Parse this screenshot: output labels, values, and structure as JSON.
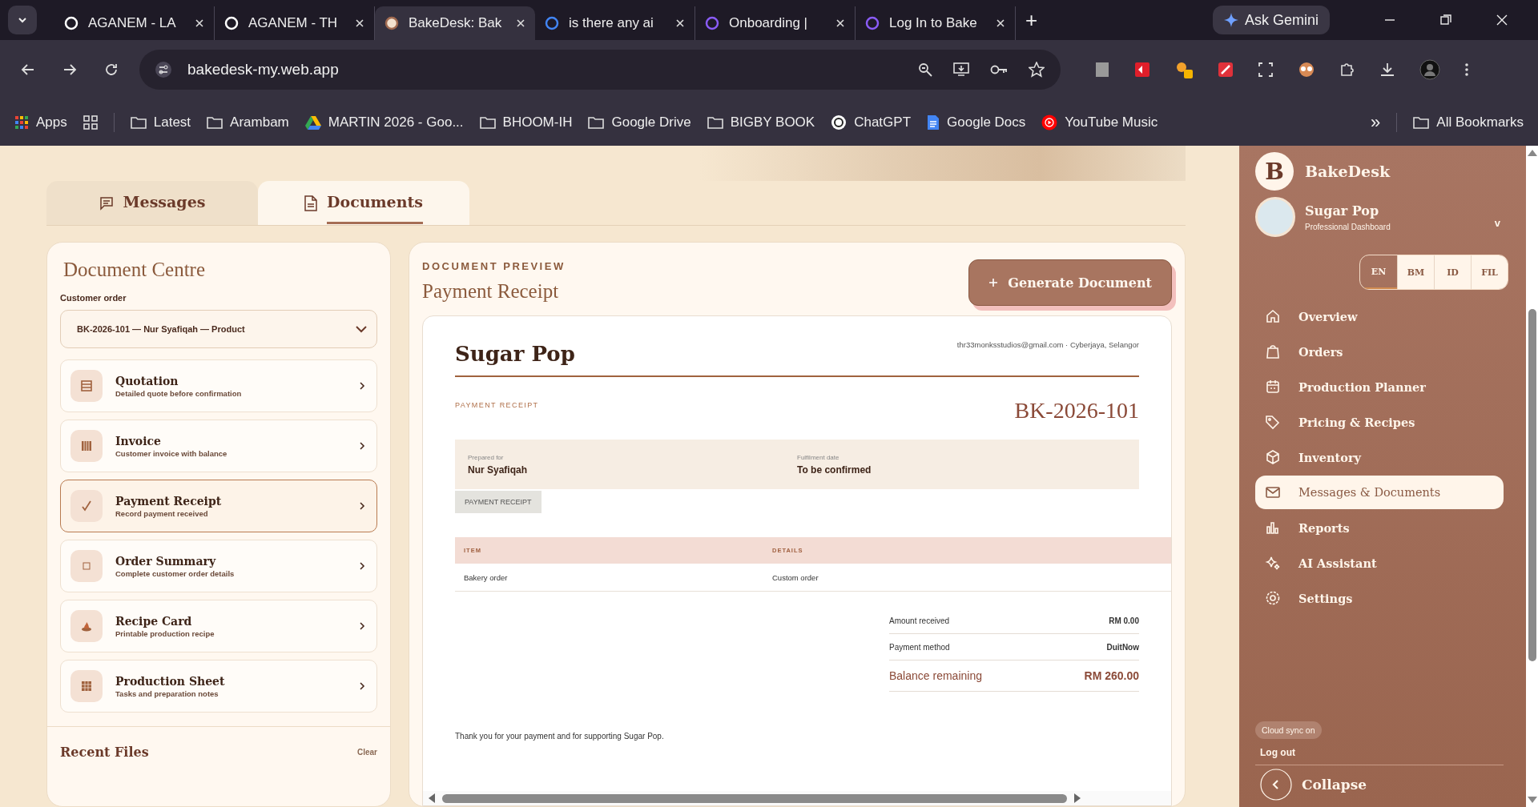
{
  "browser": {
    "tabs": [
      {
        "title": "AGANEM - LA",
        "selected": false
      },
      {
        "title": "AGANEM - TH",
        "selected": false
      },
      {
        "title": "BakeDesk: Bak",
        "selected": true
      },
      {
        "title": "is there any ai",
        "selected": false
      },
      {
        "title": "Onboarding |",
        "selected": false
      },
      {
        "title": "Log In to Bake",
        "selected": false
      }
    ],
    "new_tab": "+",
    "ask_gemini": "Ask Gemini",
    "address": "bakedesk-my.web.app",
    "bookmarks": [
      {
        "label": "Apps",
        "kind": "apps"
      },
      {
        "label": "Latest",
        "kind": "folder"
      },
      {
        "label": "Arambam",
        "kind": "folder"
      },
      {
        "label": "MARTIN 2026 - Goo...",
        "kind": "drive"
      },
      {
        "label": "BHOOM-IH",
        "kind": "folder"
      },
      {
        "label": "Google Drive",
        "kind": "folder"
      },
      {
        "label": "BIGBY BOOK",
        "kind": "folder"
      },
      {
        "label": "ChatGPT",
        "kind": "chat"
      },
      {
        "label": "Google Docs",
        "kind": "docs"
      },
      {
        "label": "YouTube Music",
        "kind": "music"
      }
    ],
    "more": "»",
    "all_bookmarks": "All Bookmarks"
  },
  "page_tabs": [
    {
      "label": "Messages",
      "selected": false
    },
    {
      "label": "Documents",
      "selected": true
    }
  ],
  "document_centre": {
    "title": "Document Centre",
    "order_label": "Customer order",
    "order_value": "BK-2026-101 — Nur Syafiqah — Product",
    "documents": [
      {
        "title": "Quotation",
        "subtitle": "Detailed quote before confirmation",
        "selected": false
      },
      {
        "title": "Invoice",
        "subtitle": "Customer invoice with balance",
        "selected": false
      },
      {
        "title": "Payment Receipt",
        "subtitle": "Record payment received",
        "selected": true
      },
      {
        "title": "Order Summary",
        "subtitle": "Complete customer order details",
        "selected": false
      },
      {
        "title": "Recipe Card",
        "subtitle": "Printable production recipe",
        "selected": false
      },
      {
        "title": "Production Sheet",
        "subtitle": "Tasks and preparation notes",
        "selected": false
      }
    ],
    "recent_files": "Recent Files",
    "clear": "Clear"
  },
  "preview": {
    "eyebrow": "DOCUMENT PREVIEW",
    "title": "Payment Receipt",
    "generate": "Generate Document",
    "document": {
      "business": "Sugar Pop",
      "contact": "thr33monksstudios@gmail.com · Cyberjaya, Selangor",
      "doc_type": "PAYMENT RECEIPT",
      "number": "BK-2026-101",
      "fields": [
        {
          "label": "Prepared for",
          "value": "Nur Syafiqah"
        },
        {
          "label": "Fulfilment date",
          "value": "To be confirmed"
        }
      ],
      "tag": "PAYMENT RECEIPT",
      "columns": [
        "ITEM",
        "DETAILS"
      ],
      "rows": [
        [
          "Bakery order",
          "Custom order"
        ]
      ],
      "totals": [
        {
          "label": "Amount received",
          "value": "RM 0.00",
          "kind": "plain"
        },
        {
          "label": "Payment method",
          "value": "DuitNow",
          "kind": "plain"
        },
        {
          "label": "Balance remaining",
          "value": "RM 260.00",
          "kind": "balance"
        }
      ],
      "note": "Thank you for your payment and for supporting Sugar Pop."
    }
  },
  "sidebar": {
    "logo_letter": "B",
    "app_name": "BakeDesk",
    "business": "Sugar Pop",
    "subtitle": "Professional Dashboard",
    "caret": "v",
    "languages": [
      {
        "code": "EN",
        "selected": true
      },
      {
        "code": "BM",
        "selected": false
      },
      {
        "code": "ID",
        "selected": false
      },
      {
        "code": "FIL",
        "selected": false
      }
    ],
    "nav": [
      {
        "label": "Overview",
        "selected": false
      },
      {
        "label": "Orders",
        "selected": false
      },
      {
        "label": "Production Planner",
        "selected": false
      },
      {
        "label": "Pricing & Recipes",
        "selected": false
      },
      {
        "label": "Inventory",
        "selected": false
      },
      {
        "label": "Messages & Documents",
        "selected": true
      },
      {
        "label": "Reports",
        "selected": false
      },
      {
        "label": "AI Assistant",
        "selected": false
      },
      {
        "label": "Settings",
        "selected": false
      }
    ],
    "sync": "Cloud sync on",
    "logout": "Log out",
    "collapse": "Collapse"
  }
}
